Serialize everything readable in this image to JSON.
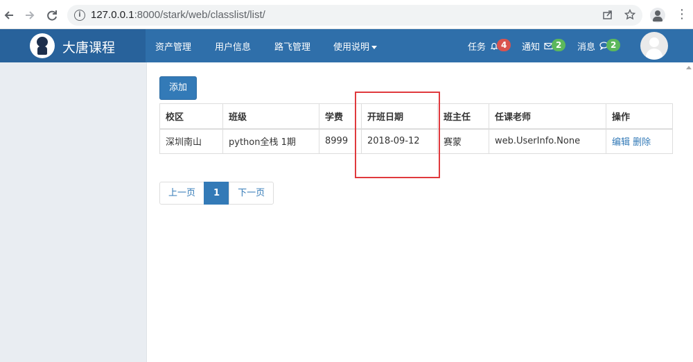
{
  "browser": {
    "url_host": "127.0.0.1",
    "url_rest": ":8000/stark/web/classlist/list/",
    "back_icon": "arrow-left-icon",
    "forward_icon": "arrow-right-icon",
    "reload_icon": "reload-icon"
  },
  "header": {
    "brand_title": "大唐课程",
    "menu": [
      "资产管理",
      "用户信息",
      "路飞管理",
      "使用说明"
    ],
    "tasks": {
      "label": "任务",
      "count": "4",
      "color": "#d9534f"
    },
    "notices": {
      "label": "通知",
      "count": "2",
      "color": "#5cb85c"
    },
    "messages": {
      "label": "消息",
      "count": "2",
      "color": "#5cb85c"
    }
  },
  "main": {
    "add_button": "添加",
    "table": {
      "columns": [
        "校区",
        "班级",
        "学费",
        "开班日期",
        "班主任",
        "任课老师",
        "操作"
      ],
      "rows": [
        {
          "campus": "深圳南山",
          "class": "python全栈 1期",
          "fee": "8999",
          "start_date": "2018-09-12",
          "head_teacher": "赛蒙",
          "teacher": "web.UserInfo.None",
          "edit": "编辑",
          "delete": "删除"
        }
      ]
    },
    "pagination": {
      "prev": "上一页",
      "current": "1",
      "next": "下一页"
    }
  }
}
